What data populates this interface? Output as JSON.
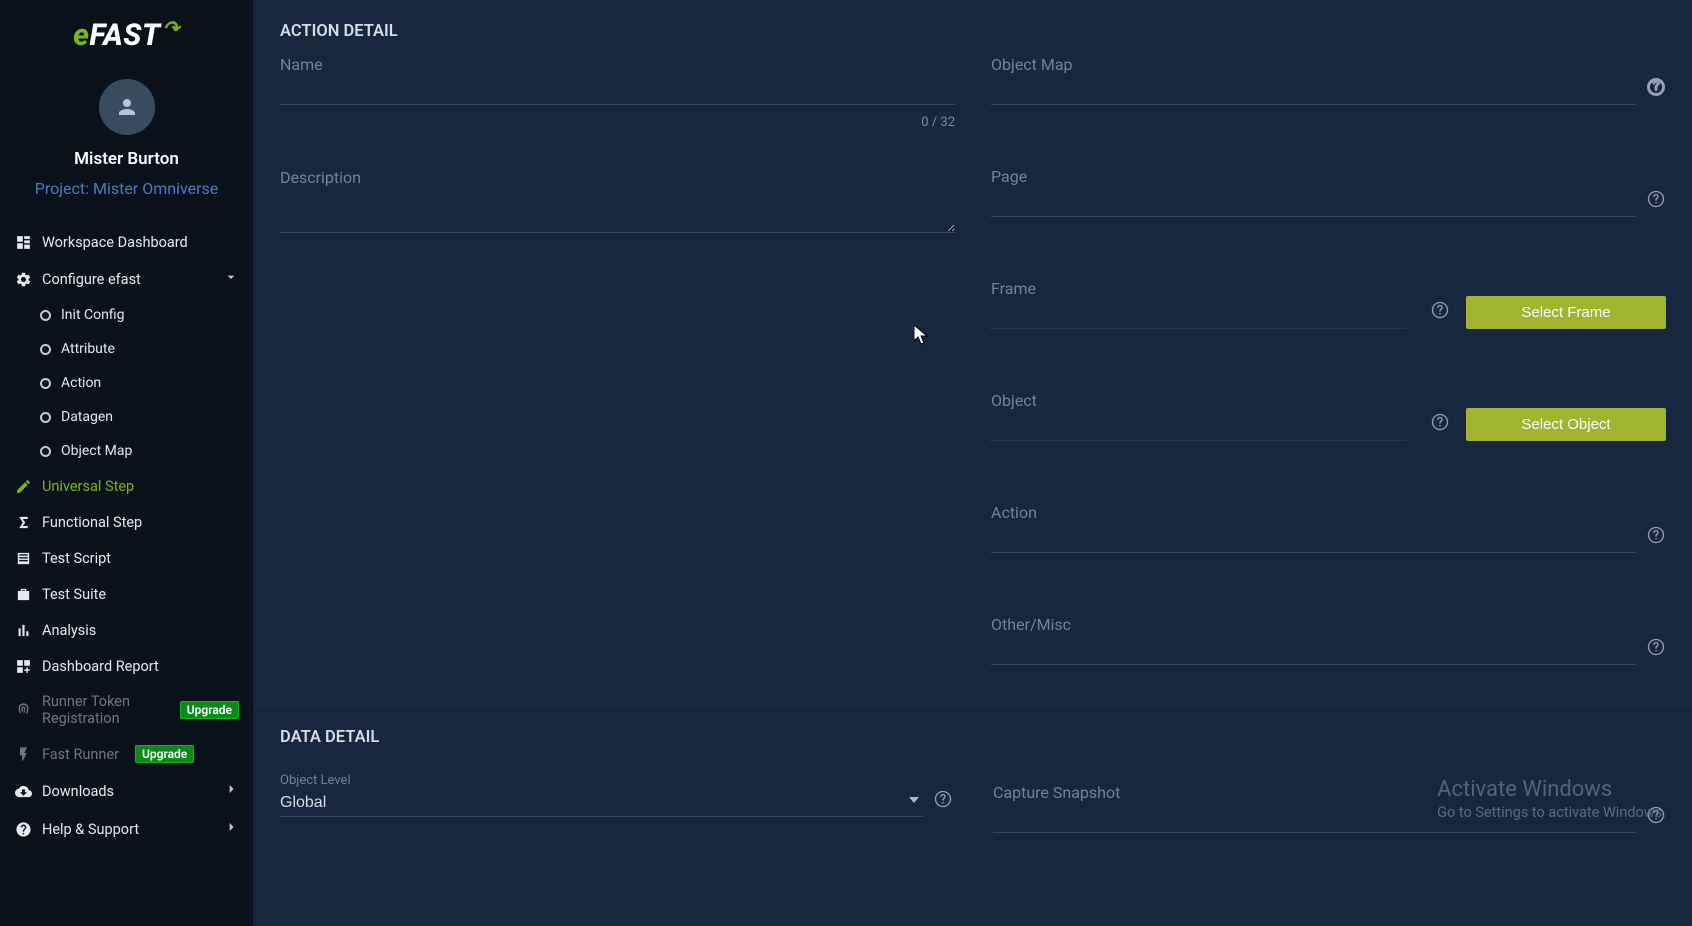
{
  "brand": {
    "prefix": "e",
    "main": "FAST"
  },
  "user": {
    "name": "Mister Burton",
    "project_prefix": "Project:",
    "project_name": "Mister Omniverse"
  },
  "sidebar": {
    "workspace": "Workspace Dashboard",
    "configure": "Configure efast",
    "sub": {
      "init": "Init Config",
      "attribute": "Attribute",
      "action": "Action",
      "datagen": "Datagen",
      "objectmap": "Object Map"
    },
    "universal": "Universal Step",
    "functional": "Functional Step",
    "testscript": "Test Script",
    "testsuite": "Test Suite",
    "analysis": "Analysis",
    "dashreport": "Dashboard Report",
    "runner_token": "Runner Token Registration",
    "fast_runner": "Fast Runner",
    "downloads": "Downloads",
    "help": "Help & Support",
    "badge_upgrade": "Upgrade"
  },
  "sections": {
    "action_detail": "ACTION DETAIL",
    "data_detail": "DATA DETAIL"
  },
  "fields": {
    "name": "Name",
    "name_counter": "0 / 32",
    "description": "Description",
    "object_map": "Object Map",
    "page": "Page",
    "frame": "Frame",
    "object": "Object",
    "action": "Action",
    "other": "Other/Misc",
    "object_level": "Object Level",
    "object_level_value": "Global",
    "capture_snapshot": "Capture Snapshot"
  },
  "buttons": {
    "select_frame": "Select Frame",
    "select_object": "Select Object"
  },
  "watermark": {
    "title": "Activate Windows",
    "sub": "Go to Settings to activate Windows."
  }
}
